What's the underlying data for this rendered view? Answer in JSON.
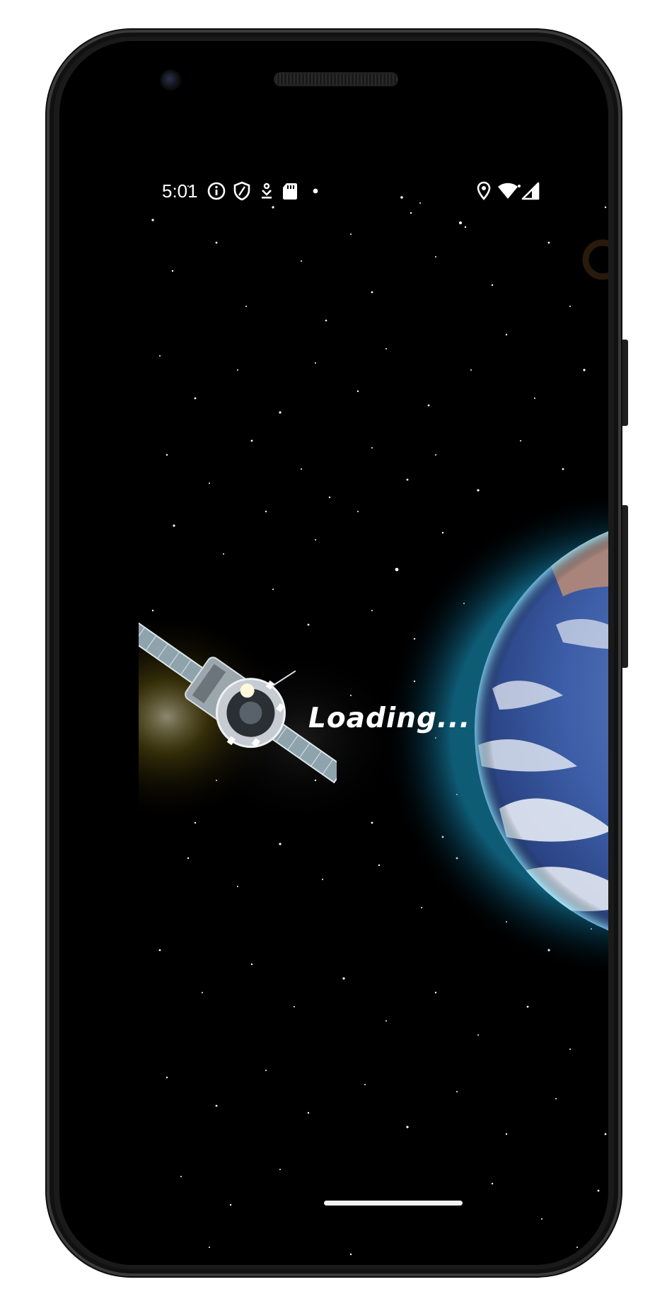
{
  "status_bar": {
    "time": "5:01",
    "left_icons": [
      "info-icon",
      "shield-icon",
      "download-icon",
      "sd-card-icon",
      "dot-icon"
    ],
    "right_icons": [
      "location-icon",
      "wifi-icon",
      "cellular-signal-icon"
    ]
  },
  "splash": {
    "loading_text": "Loading...",
    "search_icon": "search-icon",
    "search_color": "#2a1a0c"
  },
  "colors": {
    "background": "#000000",
    "text": "#ffffff",
    "earth_glow": "#2fd6ff",
    "satellite_glow": "#ffe070"
  }
}
